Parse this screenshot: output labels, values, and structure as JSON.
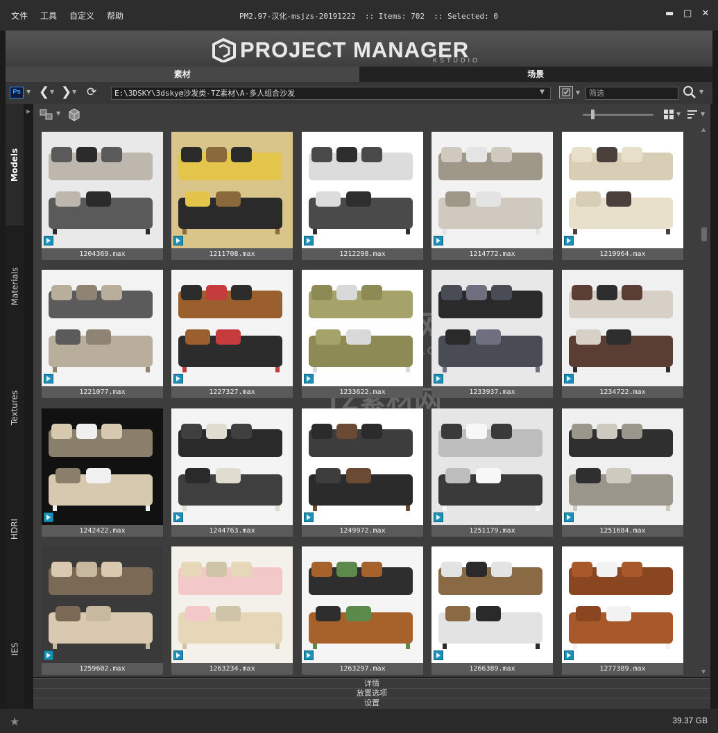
{
  "menu": [
    "文件",
    "工具",
    "自定义",
    "帮助"
  ],
  "window_title": "PM2.97-汉化-msjzs-20191222  :: Items: 702  :: Selected: 0",
  "banner": {
    "title": "PROJECT MANAGER",
    "subtitle": "KSTUDIO"
  },
  "main_tabs": [
    {
      "label": "素材",
      "active": true
    },
    {
      "label": "场景",
      "active": false
    }
  ],
  "toolbar": {
    "ps_label": "Ps",
    "path": "E:\\3DSKY\\3dsky@沙发类-TZ素材\\A-多人组合沙发",
    "search_placeholder": "筛选"
  },
  "sidebar_tabs": [
    "Models",
    "Materials",
    "Textures",
    "HDRI",
    "IES"
  ],
  "items": [
    {
      "name": "1204369.max",
      "palette": [
        "#e9e9e9",
        "#5a5a5a",
        "#bdb7ad",
        "#2b2b2b"
      ]
    },
    {
      "name": "1211708.max",
      "palette": [
        "#d9c48a",
        "#2a2a2a",
        "#e4c54b",
        "#8a6a3a"
      ]
    },
    {
      "name": "1212298.max",
      "palette": [
        "#ffffff",
        "#4a4a4a",
        "#dcdcdc",
        "#2e2e2e"
      ]
    },
    {
      "name": "1214772.max",
      "palette": [
        "#f2f2f2",
        "#cfc9c0",
        "#9f9788",
        "#e4e4e4"
      ]
    },
    {
      "name": "1219964.max",
      "palette": [
        "#ffffff",
        "#e9e0cc",
        "#d8cdb5",
        "#4a3f3a"
      ]
    },
    {
      "name": "1221077.max",
      "palette": [
        "#f3f3f3",
        "#b9ad9c",
        "#5b5b5b",
        "#8f8373"
      ]
    },
    {
      "name": "1227327.max",
      "palette": [
        "#f4f4f4",
        "#2c2c2c",
        "#9a5f2c",
        "#c63b3b"
      ]
    },
    {
      "name": "1233622.max",
      "palette": [
        "#ffffff",
        "#8d8a55",
        "#a6a36a",
        "#d9d9d9"
      ]
    },
    {
      "name": "1233937.max",
      "palette": [
        "#e8e8e8",
        "#4a4c55",
        "#2a2a2a",
        "#6e7080"
      ]
    },
    {
      "name": "1234722.max",
      "palette": [
        "#f0f0f0",
        "#5a3d33",
        "#d6d0c6",
        "#2e2e2e"
      ]
    },
    {
      "name": "1242422.max",
      "palette": [
        "#111111",
        "#d7c9b0",
        "#8a7f6b",
        "#f0f0f0"
      ]
    },
    {
      "name": "1244763.max",
      "palette": [
        "#f4f4f4",
        "#3f3f3f",
        "#2a2a2a",
        "#e0dccf"
      ]
    },
    {
      "name": "1249972.max",
      "palette": [
        "#ffffff",
        "#2b2b2b",
        "#3d3d3d",
        "#6a4a32"
      ]
    },
    {
      "name": "1251179.max",
      "palette": [
        "#e6e6e6",
        "#3a3a3a",
        "#bdbdbd",
        "#f7f7f7"
      ]
    },
    {
      "name": "1251684.max",
      "palette": [
        "#f0f0f0",
        "#9a968c",
        "#2f2f2f",
        "#cfcac0"
      ]
    },
    {
      "name": "1259602.max",
      "palette": [
        "#3a3a3a",
        "#d8c9b0",
        "#7a6a55",
        "#c7b99f"
      ]
    },
    {
      "name": "1263234.max",
      "palette": [
        "#f4f1ea",
        "#e6d7b8",
        "#f2c8c8",
        "#cfc3a8"
      ]
    },
    {
      "name": "1263297.max",
      "palette": [
        "#f5f5f5",
        "#a6622a",
        "#2e2e2e",
        "#5b8a4a"
      ]
    },
    {
      "name": "1266389.max",
      "palette": [
        "#ffffff",
        "#e3e3e3",
        "#8a6a45",
        "#2a2a2a"
      ]
    },
    {
      "name": "1277389.max",
      "palette": [
        "#ffffff",
        "#a8592c",
        "#8a4521",
        "#f2f2f2"
      ]
    }
  ],
  "bottom_panels": [
    "详情",
    "放置选项",
    "设置"
  ],
  "disk_free": "39.37 GB",
  "colors": {
    "accent": "#1a8fb8",
    "panel": "#3d3d3d",
    "card": "#5a5a5a"
  }
}
